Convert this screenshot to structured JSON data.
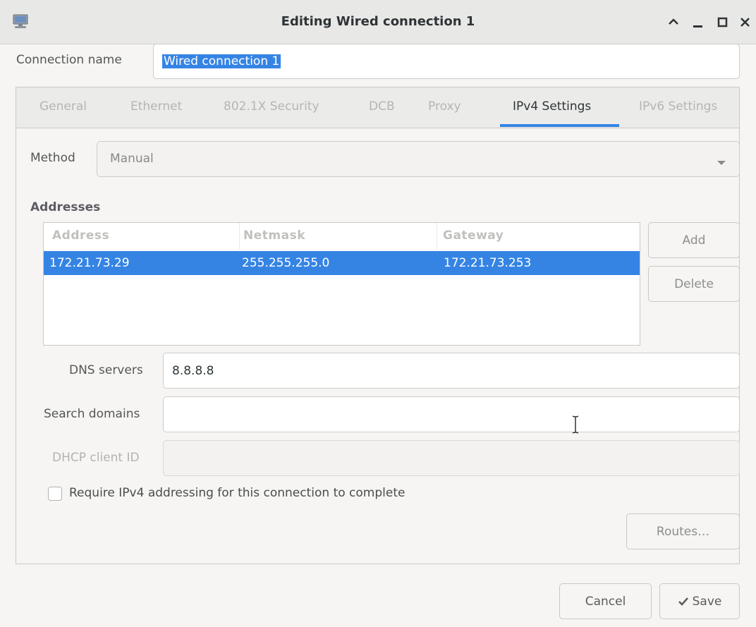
{
  "window": {
    "title": "Editing Wired connection 1",
    "icon": "network-computer-icon",
    "controls": [
      "chevron-up-icon",
      "minimize-icon",
      "maximize-icon",
      "close-icon"
    ]
  },
  "connection_name": {
    "label": "Connection name",
    "value": "Wired connection 1"
  },
  "tabs": [
    {
      "label": "General",
      "active": false
    },
    {
      "label": "Ethernet",
      "active": false
    },
    {
      "label": "802.1X Security",
      "active": false
    },
    {
      "label": "DCB",
      "active": false
    },
    {
      "label": "Proxy",
      "active": false
    },
    {
      "label": "IPv4 Settings",
      "active": true
    },
    {
      "label": "IPv6 Settings",
      "active": false
    }
  ],
  "method": {
    "label": "Method",
    "value": "Manual"
  },
  "addresses": {
    "title": "Addresses",
    "columns": [
      "Address",
      "Netmask",
      "Gateway"
    ],
    "rows": [
      {
        "address": "172.21.73.29",
        "netmask": "255.255.255.0",
        "gateway": "172.21.73.253",
        "selected": true
      }
    ],
    "add_label": "Add",
    "delete_label": "Delete"
  },
  "dns": {
    "label": "DNS servers",
    "value": "8.8.8.8"
  },
  "search_domains": {
    "label": "Search domains",
    "value": ""
  },
  "dhcp_client_id": {
    "label": "DHCP client ID",
    "value": ""
  },
  "require_ipv4": {
    "label": "Require IPv4 addressing for this connection to complete",
    "checked": false
  },
  "routes_label": "Routes…",
  "footer": {
    "cancel_label": "Cancel",
    "save_label": "Save",
    "save_icon": "checkmark-icon"
  },
  "colors": {
    "accent": "#3584e4",
    "background": "#f6f5f4"
  }
}
